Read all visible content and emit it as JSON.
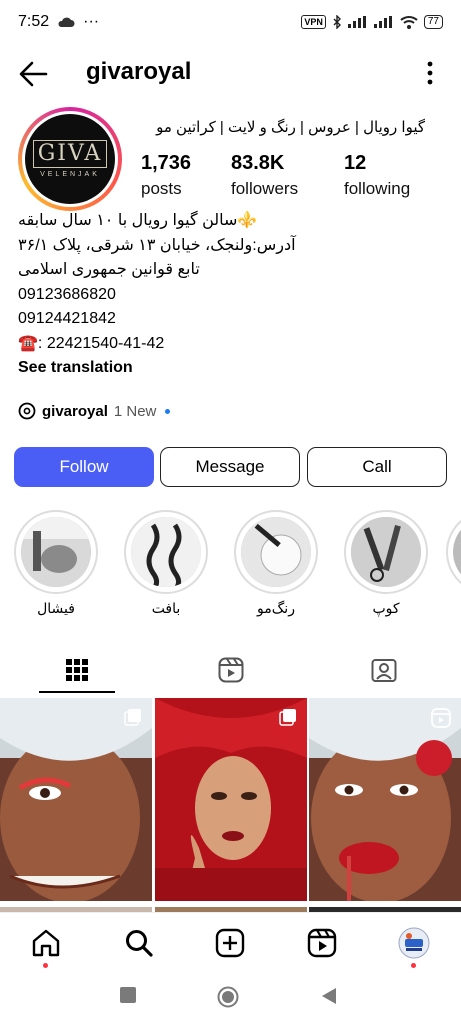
{
  "status_bar": {
    "time": "7:52",
    "dots": "···",
    "vpn": "VPN",
    "battery": "77"
  },
  "header": {
    "username": "givaroyal",
    "back_icon": "arrow-left-icon",
    "more_icon": "more-vertical-icon"
  },
  "profile": {
    "avatar_logo": "GIVA",
    "avatar_logo_sub": "VELENJAK",
    "full_name": "گیوا رویال | عروس | رنگ و لایت | کراتین مو",
    "stats": [
      {
        "value": "1,736",
        "label": "posts"
      },
      {
        "value": "83.8K",
        "label": "followers"
      },
      {
        "value": "12",
        "label": "following"
      }
    ],
    "bio_lines": [
      "⚜️سالن گیوا رویال با ۱۰ سال سابقه",
      "آدرس:ولنجک، خیابان ۱۳ شرقی، پلاک ۳۶/۱",
      "تابع قوانین جمهوری اسلامی",
      "09123686820",
      "09124421842",
      "☎️: 22421540-41-42"
    ],
    "see_translation": "See translation",
    "threads": {
      "name": "givaroyal",
      "badge": "1 New"
    }
  },
  "actions": {
    "follow": "Follow",
    "message": "Message",
    "call": "Call"
  },
  "highlights": [
    {
      "label": "فیشال"
    },
    {
      "label": "بافت"
    },
    {
      "label": "رنگ‌مو"
    },
    {
      "label": "کوپ"
    }
  ],
  "tabs": [
    {
      "name": "grid-icon"
    },
    {
      "name": "reels-icon"
    },
    {
      "name": "tagged-icon"
    }
  ],
  "colors": {
    "follow_button": "#4a5ef5",
    "accent_red": "#ff3040"
  },
  "bottom_nav": [
    {
      "name": "home-icon"
    },
    {
      "name": "search-icon"
    },
    {
      "name": "create-icon"
    },
    {
      "name": "reels-icon"
    },
    {
      "name": "profile-avatar"
    }
  ]
}
